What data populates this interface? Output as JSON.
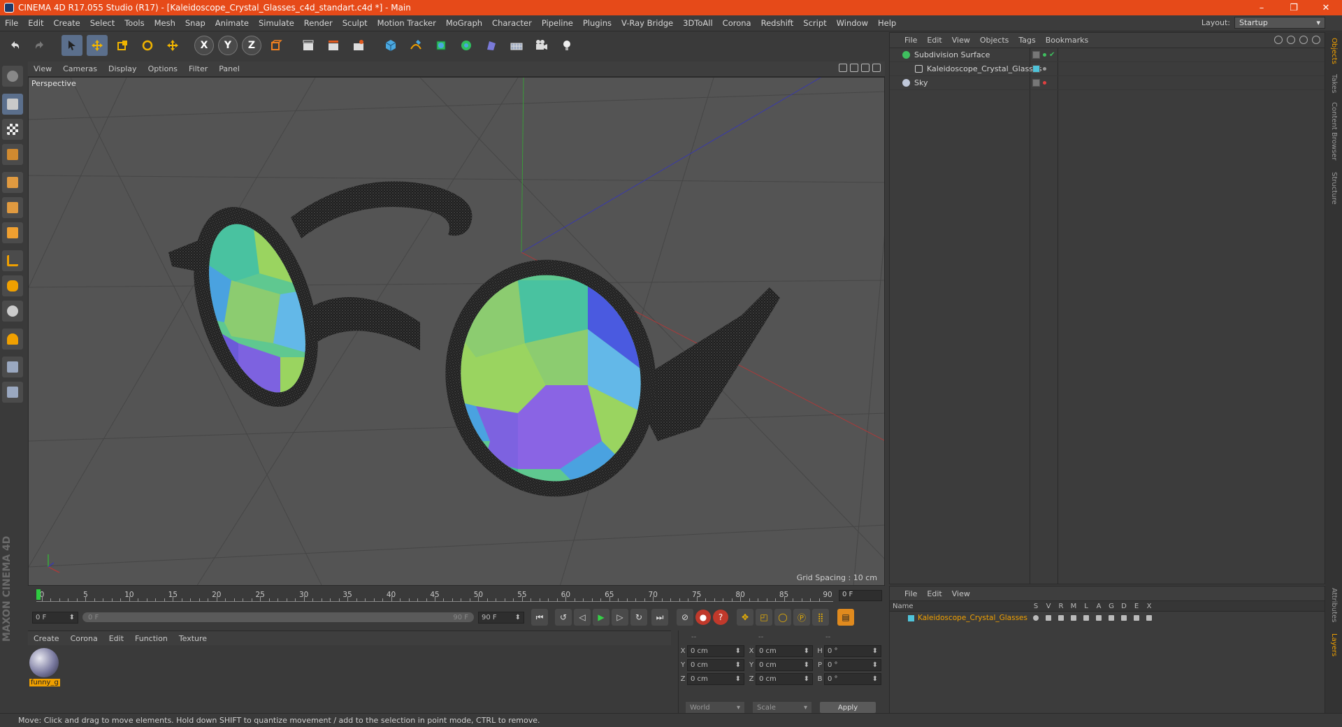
{
  "window": {
    "title": "CINEMA 4D R17.055 Studio (R17) - [Kaleidoscope_Crystal_Glasses_c4d_standart.c4d *] - Main",
    "minimize": "–",
    "maximize": "❐",
    "close": "✕"
  },
  "menu": [
    "File",
    "Edit",
    "Create",
    "Select",
    "Tools",
    "Mesh",
    "Snap",
    "Animate",
    "Simulate",
    "Render",
    "Sculpt",
    "Motion Tracker",
    "MoGraph",
    "Character",
    "Pipeline",
    "Plugins",
    "V-Ray Bridge",
    "3DToAll",
    "Corona",
    "Redshift",
    "Script",
    "Window",
    "Help"
  ],
  "layout": {
    "label": "Layout:",
    "value": "Startup"
  },
  "viewport": {
    "menu": [
      "View",
      "Cameras",
      "Display",
      "Options",
      "Filter",
      "Panel"
    ],
    "label": "Perspective",
    "grid_spacing": "Grid Spacing : 10 cm"
  },
  "timeline": {
    "ticks": [
      "0",
      "5",
      "10",
      "15",
      "20",
      "25",
      "30",
      "35",
      "40",
      "45",
      "50",
      "55",
      "60",
      "65",
      "70",
      "75",
      "80",
      "85",
      "90"
    ],
    "current_frame": "0 F"
  },
  "transport": {
    "start": "0 F",
    "slider_start": "0 F",
    "slider_end": "90 F",
    "end": "90 F"
  },
  "material_manager": {
    "menu": [
      "Create",
      "Corona",
      "Edit",
      "Function",
      "Texture"
    ],
    "material_name": "funny_g"
  },
  "coordinates": {
    "headers": [
      "--",
      "--",
      "--"
    ],
    "rows": [
      {
        "a": "X",
        "v1": "0 cm",
        "b": "X",
        "v2": "0 cm",
        "c": "H",
        "v3": "0 °"
      },
      {
        "a": "Y",
        "v1": "0 cm",
        "b": "Y",
        "v2": "0 cm",
        "c": "P",
        "v3": "0 °"
      },
      {
        "a": "Z",
        "v1": "0 cm",
        "b": "Z",
        "v2": "0 cm",
        "c": "B",
        "v3": "0 °"
      }
    ],
    "space": "World",
    "mode": "Scale",
    "apply": "Apply"
  },
  "object_manager": {
    "menu": [
      "File",
      "Edit",
      "View",
      "Objects",
      "Tags",
      "Bookmarks"
    ],
    "objects": [
      {
        "name": "Subdivision Surface",
        "color": "#3fbf5f",
        "indent": 0
      },
      {
        "name": "Kaleidoscope_Crystal_Glasses",
        "color": "#d0d0d0",
        "indent": 1
      },
      {
        "name": "Sky",
        "color": "#bfc7d9",
        "indent": 0
      }
    ]
  },
  "layer_manager": {
    "menu": [
      "File",
      "Edit",
      "View"
    ],
    "name_header": "Name",
    "columns": [
      "S",
      "V",
      "R",
      "M",
      "L",
      "A",
      "G",
      "D",
      "E",
      "X"
    ],
    "layer_name": "Kaleidoscope_Crystal_Glasses",
    "layer_color": "#4fc3d9"
  },
  "right_tabs": [
    "Objects",
    "Takes",
    "Content Browser",
    "Structure"
  ],
  "right_tabs_bottom": [
    "Attributes",
    "Layers"
  ],
  "brand": "MAXON CINEMA 4D",
  "status": "Move: Click and drag to move elements. Hold down SHIFT to quantize movement / add to the selection in point mode, CTRL to remove."
}
